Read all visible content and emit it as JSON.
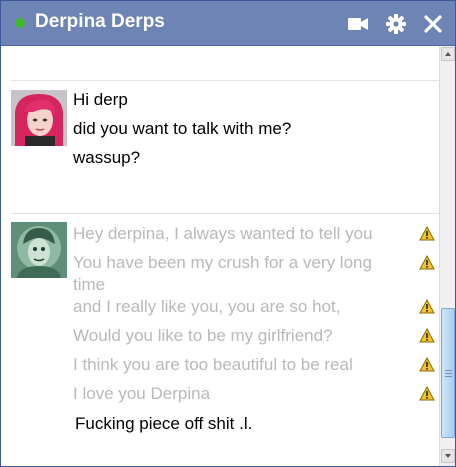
{
  "header": {
    "contact_name": "Derpina Derps",
    "status_color": "#42b72a",
    "background_color": "#6d84b4",
    "icons": [
      "video-camera-icon",
      "gear-icon",
      "close-icon"
    ]
  },
  "conversation": {
    "incoming": {
      "sender_avatar": "pink-hair-avatar",
      "messages": [
        "Hi derp",
        "did you want to talk with me?",
        "wassup?"
      ]
    },
    "outgoing": {
      "sender_avatar": "derp-avatar",
      "pending_messages": [
        "Hey derpina, I always wanted to tell you",
        "You have been my crush for a very long",
        "time",
        "and I really like you, you are so hot,",
        "Would you like to be my girlfriend?",
        "I think you are too beautiful to be real",
        "I love you Derpina"
      ],
      "pending_warning_icon": "warning-icon",
      "pending_text_color": "#b9b9b9",
      "sent_message": "Fucking piece off shit .l."
    }
  },
  "scrollbar": {
    "thumb_color": "#a9cdf0"
  }
}
